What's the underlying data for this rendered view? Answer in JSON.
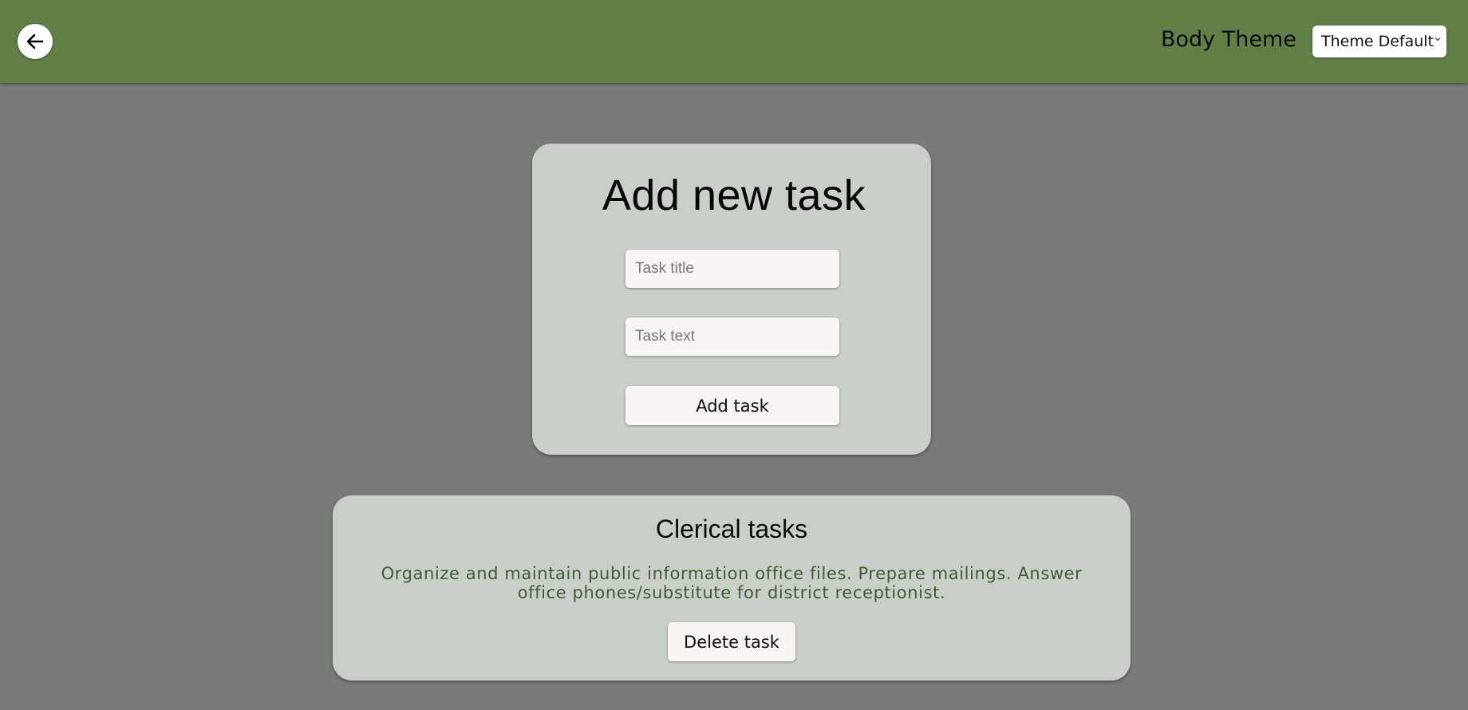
{
  "header": {
    "back_icon": "arrow-left-icon",
    "theme_label": "Body Theme",
    "theme_select": {
      "selected": "Theme Default",
      "chevron_icon": "chevron-down-icon"
    },
    "bar_color": "#627f48"
  },
  "add_task": {
    "title": "Add new task",
    "task_title_placeholder": "Task title",
    "task_text_placeholder": "Task text",
    "submit_label": "Add task"
  },
  "tasks": [
    {
      "title": "Clerical tasks",
      "text": "Organize and maintain public information office files. Prepare mailings. Answer office phones/substitute for district receptionist.",
      "delete_label": "Delete task"
    }
  ],
  "colors": {
    "background": "#7a7a7a",
    "card": "#c9cfc8",
    "task_text": "#3f5a35",
    "control": "#f8f4f3"
  }
}
